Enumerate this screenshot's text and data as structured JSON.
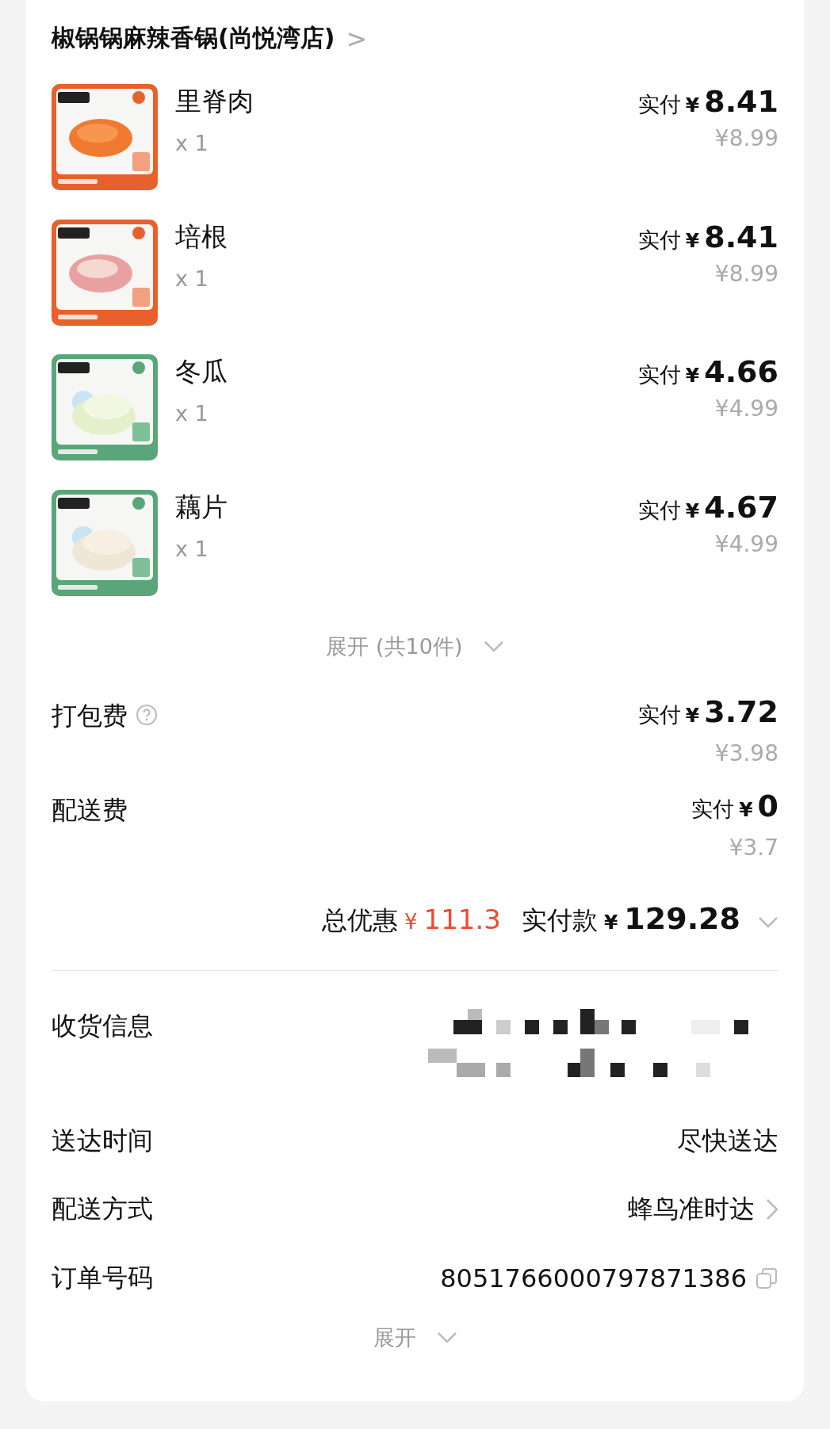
{
  "store": {
    "name": "椒锅锅麻辣香锅(尚悦湾店)",
    "chevron": ">"
  },
  "items": [
    {
      "name": "里脊肉",
      "quantity": "x 1",
      "paid_label": "实付",
      "currency": "¥",
      "paid": "8.41",
      "original": "¥8.99"
    },
    {
      "name": "培根",
      "quantity": "x 1",
      "paid_label": "实付",
      "currency": "¥",
      "paid": "8.41",
      "original": "¥8.99"
    },
    {
      "name": "冬瓜",
      "quantity": "x 1",
      "paid_label": "实付",
      "currency": "¥",
      "paid": "4.66",
      "original": "¥4.99"
    },
    {
      "name": "藕片",
      "quantity": "x 1",
      "paid_label": "实付",
      "currency": "¥",
      "paid": "4.67",
      "original": "¥4.99"
    }
  ],
  "expand_items": "展开 (共10件)",
  "fees": [
    {
      "label": "打包费",
      "has_help": true,
      "paid_label": "实付",
      "currency": "¥",
      "paid": "3.72",
      "original": "¥3.98"
    },
    {
      "label": "配送费",
      "has_help": false,
      "paid_label": "实付",
      "currency": "¥",
      "paid": "0",
      "original": "¥3.7"
    }
  ],
  "summary": {
    "discount_label": "总优惠",
    "discount_currency": "¥",
    "discount": "111.3",
    "total_label": "实付款",
    "total_currency": "¥",
    "total": "129.28"
  },
  "info": [
    {
      "kind": "redacted",
      "label": "收货信息"
    },
    {
      "kind": "text",
      "label": "送达时间",
      "value": "尽快送达"
    },
    {
      "kind": "link",
      "label": "配送方式",
      "value": "蜂鸟准时达"
    },
    {
      "kind": "copy",
      "label": "订单号码",
      "value": "8051766000797871386"
    }
  ],
  "expand_info": "展开"
}
